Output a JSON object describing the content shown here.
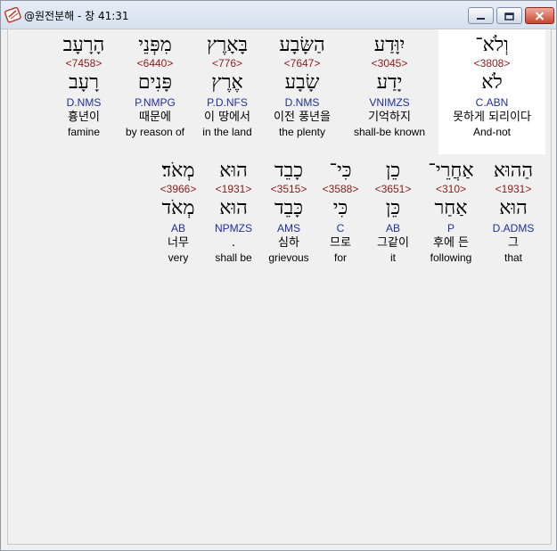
{
  "window": {
    "title": "@원전분해 - 창 41:31"
  },
  "verse": {
    "line1": [
      {
        "heb": "וְלֹא־",
        "strong": "<3808>",
        "lemma": "לֹא",
        "morph": "C.ABN",
        "kor": "못하게 되리이다",
        "eng": "And-not",
        "selected": true
      },
      {
        "heb": "יִוָּדַע",
        "strong": "<3045>",
        "lemma": "יָדַע",
        "morph": "VNIMZS",
        "kor": "기억하지",
        "eng": "shall-be known"
      },
      {
        "heb": "הַשָּׂבָע",
        "strong": "<7647>",
        "lemma": "שָׂבָע",
        "morph": "D.NMS",
        "kor": "이전 풍년을",
        "eng": "the plenty"
      },
      {
        "heb": "בָּאָרֶץ",
        "strong": "<776>",
        "lemma": "אֶרֶץ",
        "morph": "P.D.NFS",
        "kor": "이 땅에서",
        "eng": "in the land"
      },
      {
        "heb": "מִפְּנֵי",
        "strong": "<6440>",
        "lemma": "פָּנִים",
        "morph": "P.NMPG",
        "kor": "때문에",
        "eng": "by reason of"
      },
      {
        "heb": "הָרָעָב",
        "strong": "<7458>",
        "lemma": "רָעָב",
        "morph": "D.NMS",
        "kor": "흉년이",
        "eng": "famine"
      }
    ],
    "line2": [
      {
        "heb": "הַהוּא",
        "strong": "<1931>",
        "lemma": "הוּא",
        "morph": "D.ADMS",
        "kor": "그",
        "eng": "that"
      },
      {
        "heb": "אַחֲרֵי־",
        "strong": "<310>",
        "lemma": "אַחַר",
        "morph": "P",
        "kor": "후에 든",
        "eng": "following"
      },
      {
        "heb": "כֵן",
        "strong": "<3651>",
        "lemma": "כֵּן",
        "morph": "AB",
        "kor": "그같이",
        "eng": "it"
      },
      {
        "heb": "כִּי־",
        "strong": "<3588>",
        "lemma": "כִּי",
        "morph": "C",
        "kor": "므로",
        "eng": "for"
      },
      {
        "heb": "כָבֵד",
        "strong": "<3515>",
        "lemma": "כָּבֵד",
        "morph": "AMS",
        "kor": "심하",
        "eng": "grievous"
      },
      {
        "heb": "הוּא",
        "strong": "<1931>",
        "lemma": "הוּא",
        "morph": "NPMZS",
        "kor": ".",
        "eng": "shall be"
      },
      {
        "heb": "מְאֹד׃",
        "strong": "<3966>",
        "lemma": "מְאֹד",
        "morph": "AB",
        "kor": "너무",
        "eng": "very"
      }
    ]
  },
  "colors": {
    "strong": "#8b1a1a",
    "morph": "#1f2f9e",
    "titlebar": "#dbe4f0",
    "close": "#c8432f"
  },
  "icons": {
    "app": "app-logo-icon",
    "minimize": "minimize-icon",
    "maximize": "maximize-icon",
    "close": "close-icon"
  }
}
